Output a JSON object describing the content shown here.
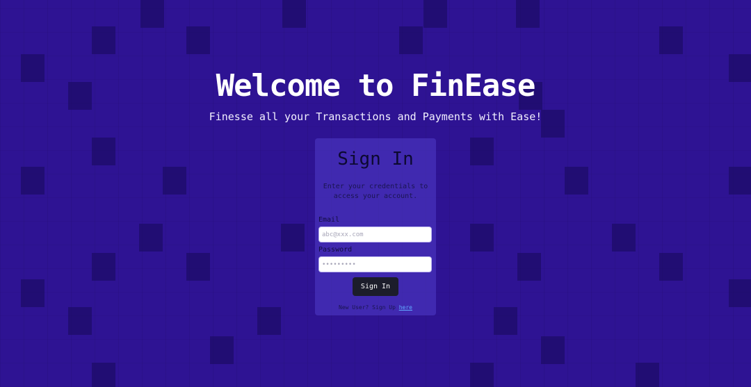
{
  "hero": {
    "title": "Welcome to FinEase",
    "subtitle": "Finesse all your Transactions and Payments with Ease!"
  },
  "signin": {
    "heading": "Sign In",
    "description": "Enter your credentials to access your account.",
    "email_label": "Email",
    "email_placeholder": "abc@xxx.com",
    "password_label": "Password",
    "password_placeholder": "•••••••••",
    "button_label": "Sign In",
    "signup_prompt": "New User? Sign Up ",
    "signup_link": "here"
  },
  "colors": {
    "background": "#2e1393",
    "card": "#503cc8",
    "button": "#1c1d2b",
    "link": "#60a8ff"
  }
}
